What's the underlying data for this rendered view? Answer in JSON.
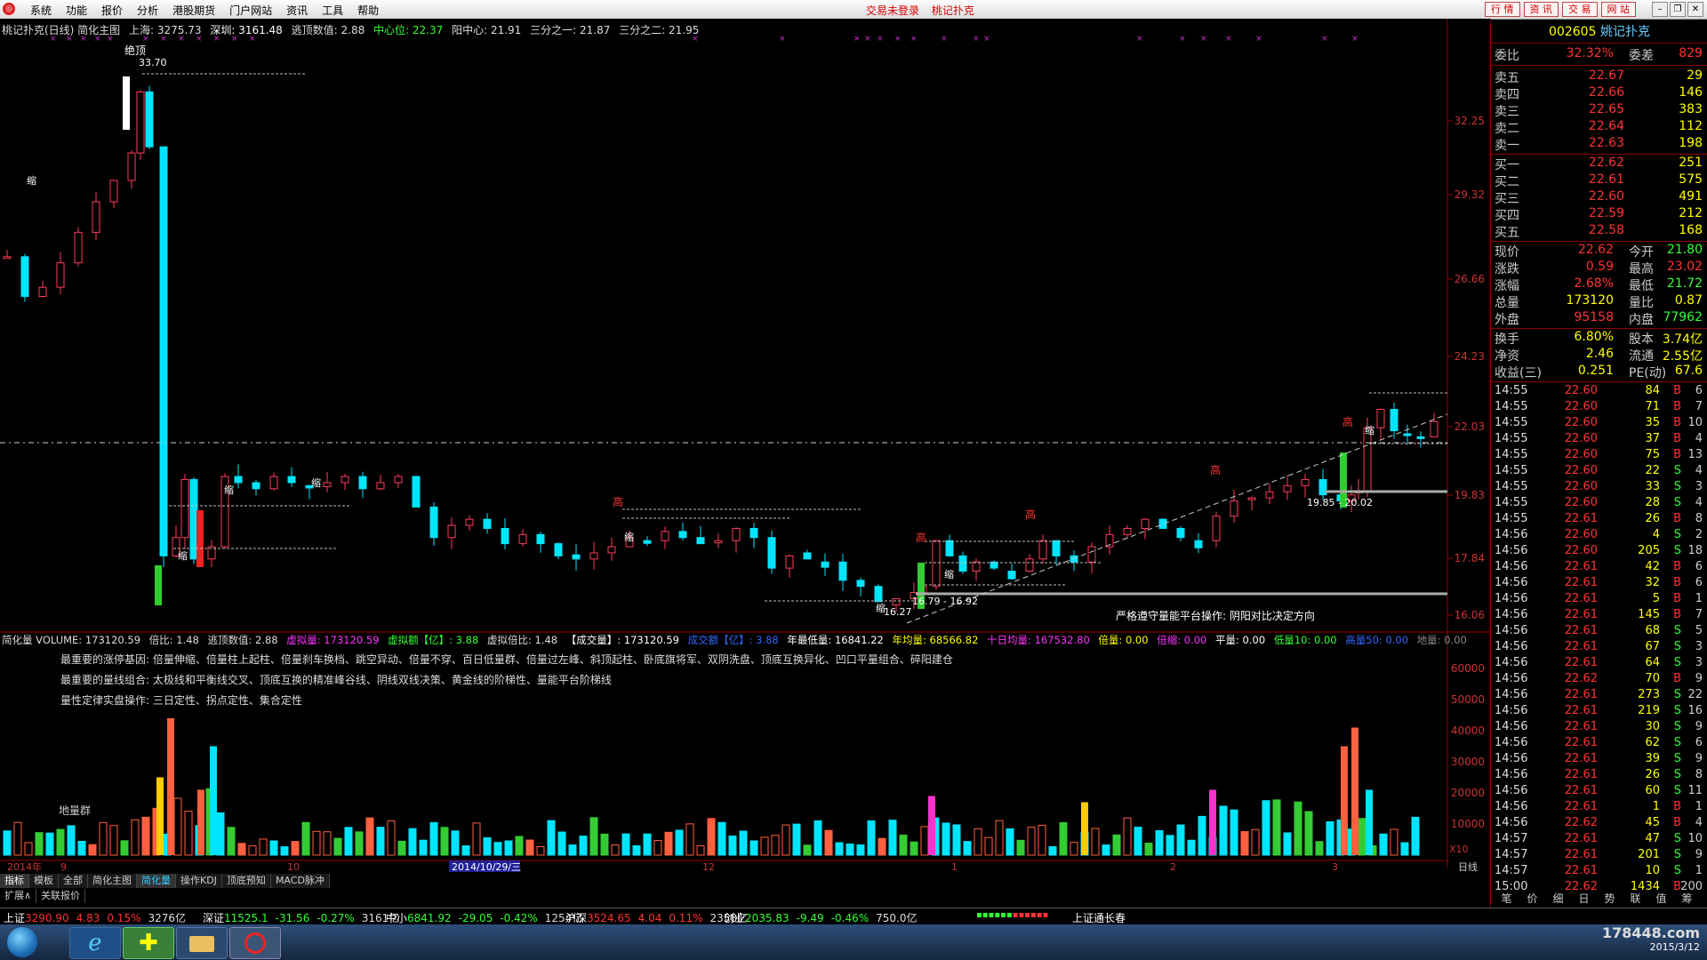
{
  "menubar": {
    "items": [
      "系统",
      "功能",
      "报价",
      "分析",
      "港股期货",
      "门户网站",
      "资讯",
      "工具",
      "帮助"
    ],
    "status": [
      "交易未登录",
      "桃记扑克"
    ],
    "right_buttons": [
      "行 情",
      "资 讯",
      "交 易",
      "网 站"
    ]
  },
  "chart": {
    "title": "桃记扑克(日线) 简化主图",
    "info": {
      "sh": "上海: 3275.73",
      "sz": "深圳: 3161.48",
      "escape": "逃顶数值: 2.88",
      "center": "中心位: 22.37",
      "yang": "阳中心: 21.91",
      "third1": "三分之一: 21.87",
      "third2": "三分之二: 21.95"
    },
    "price_ticks": [
      "32.25",
      "29.32",
      "26.66",
      "24.23",
      "22.03",
      "19.83",
      "17.84",
      "16.06"
    ],
    "annotations": {
      "peak_label": "绝顶",
      "peak_value": "33.70",
      "low_value": "16.27",
      "range1": "16.79 - 16.92",
      "range2": "19.85 - 20.02",
      "gao": "高",
      "suo": "缩",
      "note": "严格遵守量能平台操作: 阴阳对比决定方向"
    },
    "date_labels": [
      "2014年",
      "9",
      "10",
      "12",
      "1",
      "2",
      "3"
    ],
    "cursor_date": "2014/10/29/三",
    "period": "日线"
  },
  "volume": {
    "info": {
      "label": "简化量 VOLUME: 173120.59",
      "ratio": "倍比: 1.48",
      "escape": "逃顶数值: 2.88",
      "virtual": "虚拟量: 173120.59",
      "vamount": "虚拟额【亿】: 3.88",
      "vratio": "虚拟倍比: 1.48",
      "deal": "【成交量】: 173120.59",
      "amount": "成交额【亿】: 3.88",
      "ylow": "年最低量: 16841.22",
      "yavg": "年均量: 68566.82",
      "ma10": "十日均量: 167532.80",
      "bei": "倍量: 0.00",
      "beisuo": "倍缩: 0.00",
      "ping": "平量: 0.00",
      "low10": "低量10: 0.00",
      "high50": "高量50: 0.00",
      "di": "地量: 0.00"
    },
    "text1": "最重要的涨停基因: 倍量伸缩、倍量柱上起柱、倍量刹车换档、跳空异动、倍量不穿、百日低量群、倍量过左峰、斜顶起柱、卧底旗将军、双阴洗盘、顶底互换异化、凹口平量组合、碎阳建仓",
    "text2": "最重要的量线组合: 太极线和平衡线交叉、顶底互换的精准峰谷线、阴线双线决策、黄金线的阶梯性、量能平台阶梯线",
    "text3": "量性定律实盘操作: 三日定性、拐点定性、集合定性",
    "dil": "地量群",
    "vol_ticks": [
      "60000",
      "50000",
      "40000",
      "30000",
      "20000",
      "10000"
    ],
    "unit": "X10"
  },
  "rightpanel": {
    "code": "002605",
    "name": "姚记扑克",
    "weibi_label": "委比",
    "weibi": "32.32%",
    "weicha_label": "委差",
    "weicha": "829",
    "sells": [
      {
        "label": "卖五",
        "price": "22.67",
        "vol": "29"
      },
      {
        "label": "卖四",
        "price": "22.66",
        "vol": "146"
      },
      {
        "label": "卖三",
        "price": "22.65",
        "vol": "383"
      },
      {
        "label": "卖二",
        "price": "22.64",
        "vol": "112"
      },
      {
        "label": "卖一",
        "price": "22.63",
        "vol": "198"
      }
    ],
    "buys": [
      {
        "label": "买一",
        "price": "22.62",
        "vol": "251"
      },
      {
        "label": "买二",
        "price": "22.61",
        "vol": "575"
      },
      {
        "label": "买三",
        "price": "22.60",
        "vol": "491"
      },
      {
        "label": "买四",
        "price": "22.59",
        "vol": "212"
      },
      {
        "label": "买五",
        "price": "22.58",
        "vol": "168"
      }
    ],
    "stats": [
      {
        "l": "现价",
        "v": "22.62",
        "l2": "今开",
        "v2": "21.80"
      },
      {
        "l": "涨跌",
        "v": "0.59",
        "l2": "最高",
        "v2": "23.02"
      },
      {
        "l": "涨幅",
        "v": "2.68%",
        "l2": "最低",
        "v2": "21.72"
      },
      {
        "l": "总量",
        "v": "173120",
        "l2": "量比",
        "v2": "0.87"
      },
      {
        "l": "外盘",
        "v": "95158",
        "l2": "内盘",
        "v2": "77962"
      }
    ],
    "stats2": [
      {
        "l": "换手",
        "v": "6.80%",
        "l2": "股本",
        "v2": "3.74亿"
      },
      {
        "l": "净资",
        "v": "2.46",
        "l2": "流通",
        "v2": "2.55亿"
      },
      {
        "l": "收益(三)",
        "v": "0.251",
        "l2": "PE(动)",
        "v2": "67.6"
      }
    ],
    "ticks": [
      [
        "14:55",
        "22.60",
        "84",
        "B",
        "6"
      ],
      [
        "14:55",
        "22.60",
        "71",
        "B",
        "7"
      ],
      [
        "14:55",
        "22.60",
        "35",
        "B",
        "10"
      ],
      [
        "14:55",
        "22.60",
        "37",
        "B",
        "4"
      ],
      [
        "14:55",
        "22.60",
        "75",
        "B",
        "13"
      ],
      [
        "14:55",
        "22.60",
        "22",
        "S",
        "4"
      ],
      [
        "14:55",
        "22.60",
        "33",
        "S",
        "3"
      ],
      [
        "14:55",
        "22.60",
        "28",
        "S",
        "4"
      ],
      [
        "14:55",
        "22.61",
        "26",
        "B",
        "8"
      ],
      [
        "14:56",
        "22.60",
        "4",
        "S",
        "2"
      ],
      [
        "14:56",
        "22.60",
        "205",
        "S",
        "18"
      ],
      [
        "14:56",
        "22.61",
        "42",
        "B",
        "6"
      ],
      [
        "14:56",
        "22.61",
        "32",
        "B",
        "6"
      ],
      [
        "14:56",
        "22.61",
        "5",
        "B",
        "1"
      ],
      [
        "14:56",
        "22.61",
        "145",
        "B",
        "7"
      ],
      [
        "14:56",
        "22.61",
        "68",
        "S",
        "5"
      ],
      [
        "14:56",
        "22.61",
        "67",
        "S",
        "3"
      ],
      [
        "14:56",
        "22.61",
        "64",
        "S",
        "3"
      ],
      [
        "14:56",
        "22.62",
        "70",
        "B",
        "9"
      ],
      [
        "14:56",
        "22.61",
        "273",
        "S",
        "22"
      ],
      [
        "14:56",
        "22.61",
        "219",
        "S",
        "16"
      ],
      [
        "14:56",
        "22.61",
        "30",
        "S",
        "9"
      ],
      [
        "14:56",
        "22.61",
        "62",
        "S",
        "6"
      ],
      [
        "14:56",
        "22.61",
        "39",
        "S",
        "9"
      ],
      [
        "14:56",
        "22.61",
        "26",
        "S",
        "8"
      ],
      [
        "14:56",
        "22.61",
        "60",
        "S",
        "11"
      ],
      [
        "14:56",
        "22.61",
        "1",
        "B",
        "1"
      ],
      [
        "14:56",
        "22.62",
        "45",
        "B",
        "4"
      ],
      [
        "14:57",
        "22.61",
        "47",
        "S",
        "10"
      ],
      [
        "14:57",
        "22.61",
        "201",
        "S",
        "9"
      ],
      [
        "14:57",
        "22.61",
        "10",
        "S",
        "1"
      ],
      [
        "15:00",
        "22.62",
        "1434",
        "B",
        "200"
      ]
    ],
    "tabs": [
      "笔",
      "价",
      "细",
      "日",
      "势",
      "联",
      "值",
      "筹"
    ]
  },
  "bottom_tabs": [
    "指标",
    "模板",
    "全部",
    "简化主图",
    "简化量",
    "操作KDJ",
    "顶底预知",
    "MACD脉冲"
  ],
  "bottom_tabs2": [
    "扩展∧",
    "关联报价"
  ],
  "indexbar": {
    "sh": {
      "name": "上证",
      "val": "3290.90",
      "chg": "4.83",
      "pct": "0.15%",
      "amt": "3276亿"
    },
    "sz": {
      "name": "深证",
      "val": "11525.1",
      "chg": "-31.56",
      "pct": "-0.27%",
      "amt": "3161亿"
    },
    "zx": {
      "name": "中小",
      "val": "6841.92",
      "chg": "-29.05",
      "pct": "-0.42%",
      "amt": "1254亿"
    },
    "hs": {
      "name": "沪深",
      "val": "3524.65",
      "chg": "4.04",
      "pct": "0.11%",
      "amt": "2358亿"
    },
    "cy": {
      "name": "创业",
      "val": "2035.83",
      "chg": "-9.49",
      "pct": "-0.46%",
      "amt": "750.0亿"
    },
    "broker": "上证通长春"
  },
  "taskbar": {
    "watermark": "178448.com",
    "date": "2015/3/12"
  },
  "chart_data": {
    "type": "candlestick",
    "colors": {
      "up": "#ff3b5c",
      "down": "#00e5ff",
      "vol_up": "#ff6040",
      "vol_down": "#00e5ff"
    },
    "ylim": [
      16.06,
      34.5
    ],
    "vol_ylim": [
      0,
      65000
    ]
  }
}
